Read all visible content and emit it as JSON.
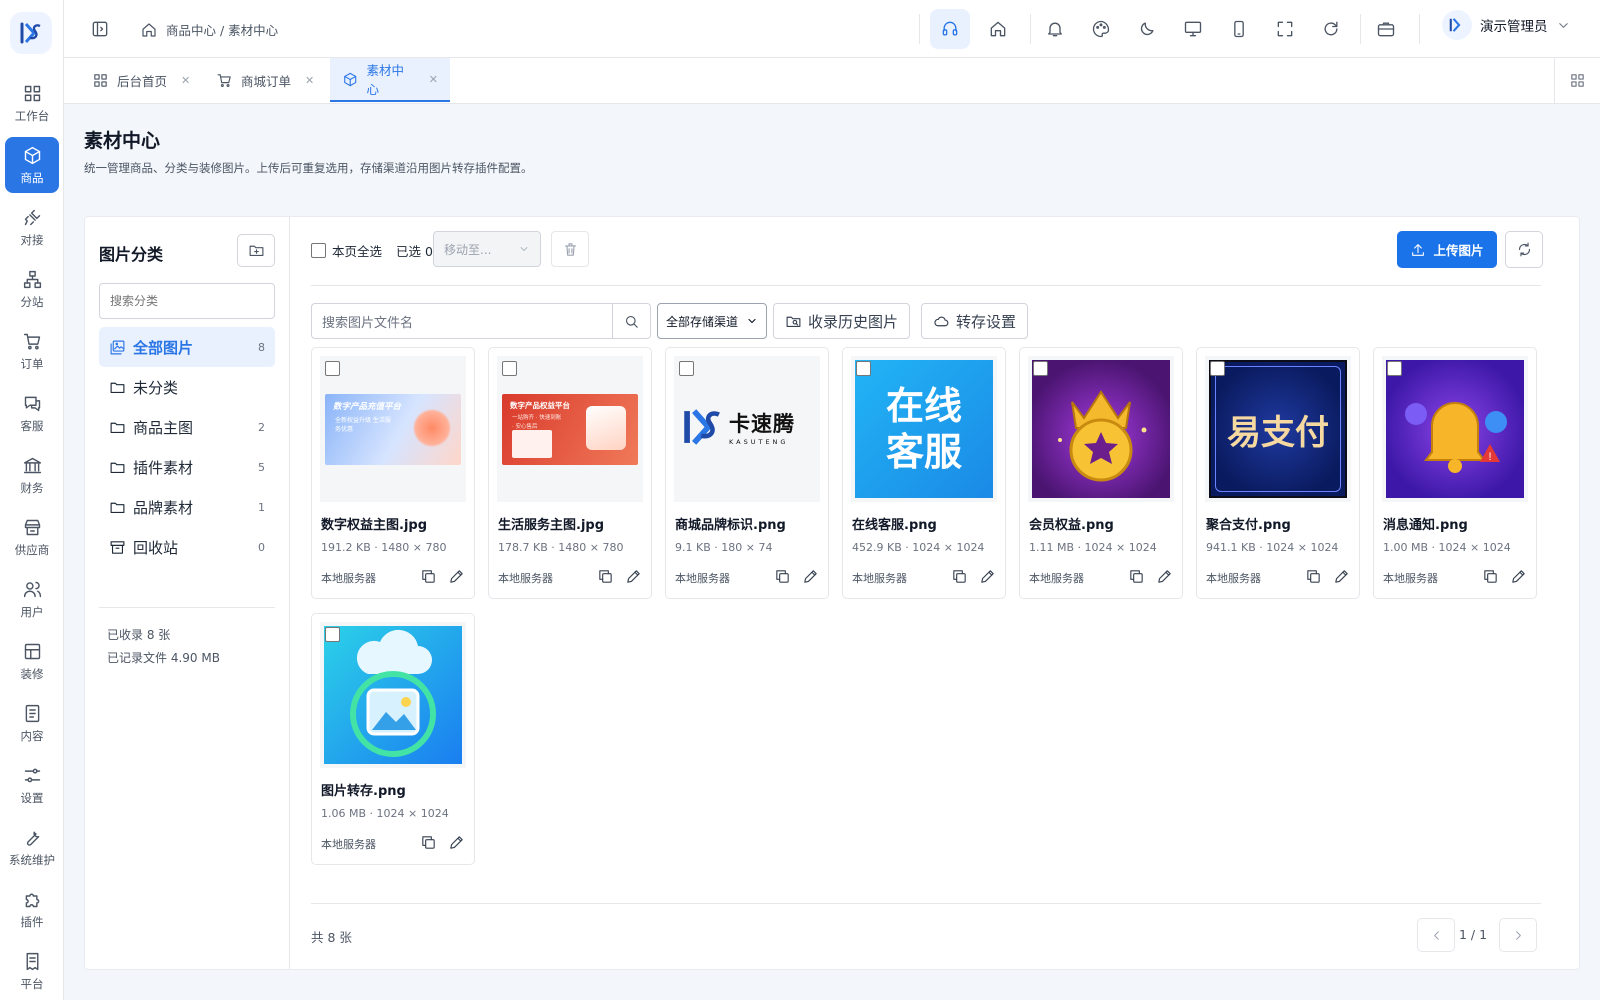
{
  "rail": {
    "items": [
      {
        "label": "工作台",
        "icon": "grid-icon"
      },
      {
        "label": "商品",
        "icon": "box-icon"
      },
      {
        "label": "对接",
        "icon": "plug-icon"
      },
      {
        "label": "分站",
        "icon": "sitemap-icon"
      },
      {
        "label": "订单",
        "icon": "cart-icon"
      },
      {
        "label": "客服",
        "icon": "chat-icon"
      },
      {
        "label": "财务",
        "icon": "bank-icon"
      },
      {
        "label": "供应商",
        "icon": "store-icon"
      },
      {
        "label": "用户",
        "icon": "users-icon"
      },
      {
        "label": "装修",
        "icon": "layout-icon"
      },
      {
        "label": "内容",
        "icon": "document-icon"
      },
      {
        "label": "设置",
        "icon": "sliders-icon"
      },
      {
        "label": "系统维护",
        "icon": "wrench-icon"
      },
      {
        "label": "插件",
        "icon": "puzzle-icon"
      },
      {
        "label": "平台",
        "icon": "receipt-icon"
      }
    ],
    "active_index": 1
  },
  "header": {
    "breadcrumb": "商品中心 / 素材中心",
    "user_name": "演示管理员"
  },
  "tabs": [
    {
      "label": "后台首页",
      "icon": "grid-icon"
    },
    {
      "label": "商城订单",
      "icon": "cart-icon"
    },
    {
      "label": "素材中心",
      "icon": "box-icon",
      "active": true
    }
  ],
  "page": {
    "title": "素材中心",
    "description": "统一管理商品、分类与装修图片。上传后可重复选用，存储渠道沿用图片转存插件配置。"
  },
  "sidebar": {
    "title": "图片分类",
    "search_placeholder": "搜索分类",
    "categories": [
      {
        "label": "全部图片",
        "count": "8",
        "icon": "images-icon"
      },
      {
        "label": "未分类",
        "count": "",
        "icon": "folder-icon"
      },
      {
        "label": "商品主图",
        "count": "2",
        "icon": "folder-icon"
      },
      {
        "label": "插件素材",
        "count": "5",
        "icon": "folder-icon"
      },
      {
        "label": "品牌素材",
        "count": "1",
        "icon": "folder-icon"
      },
      {
        "label": "回收站",
        "count": "0",
        "icon": "archive-icon"
      }
    ],
    "stats": {
      "collected": "已收录 8 张",
      "recorded": "已记录文件 4.90 MB"
    }
  },
  "toolbar": {
    "select_all": "本页全选",
    "selected": "已选 0",
    "move_to": "移动至...",
    "upload": "上传图片"
  },
  "filters": {
    "search_placeholder": "搜索图片文件名",
    "storage_select": "全部存储渠道",
    "history_button": "收录历史图片",
    "transfer_button": "转存设置"
  },
  "images": [
    {
      "name": "数字权益主图.jpg",
      "meta": "191.2 KB · 1480 × 780",
      "storage": "本地服务器",
      "thumb_text": "数字产品充值平台",
      "thumb_sub": "全新权益升级 生活服务优惠"
    },
    {
      "name": "生活服务主图.jpg",
      "meta": "178.7 KB · 1480 × 780",
      "storage": "本地服务器",
      "thumb_text": "数字产品权益平台",
      "thumb_sub": "一站购齐 · 快速到账 · 安心售后"
    },
    {
      "name": "商城品牌标识.png",
      "meta": "9.1 KB · 180 × 74",
      "storage": "本地服务器",
      "thumb_text": "卡速腾",
      "thumb_sub": "KASUTENG"
    },
    {
      "name": "在线客服.png",
      "meta": "452.9 KB · 1024 × 1024",
      "storage": "本地服务器",
      "thumb_text": "在线",
      "thumb_sub": "客服"
    },
    {
      "name": "会员权益.png",
      "meta": "1.11 MB · 1024 × 1024",
      "storage": "本地服务器"
    },
    {
      "name": "聚合支付.png",
      "meta": "941.1 KB · 1024 × 1024",
      "storage": "本地服务器",
      "thumb_text": "易支付"
    },
    {
      "name": "消息通知.png",
      "meta": "1.00 MB · 1024 × 1024",
      "storage": "本地服务器"
    },
    {
      "name": "图片转存.png",
      "meta": "1.06 MB · 1024 × 1024",
      "storage": "本地服务器"
    }
  ],
  "footer": {
    "total": "共 8 张",
    "page": "1 / 1"
  },
  "colors": {
    "primary": "#1a73e8",
    "active_bg": "#e9f1ff",
    "rail_active": "#2b76e5"
  }
}
